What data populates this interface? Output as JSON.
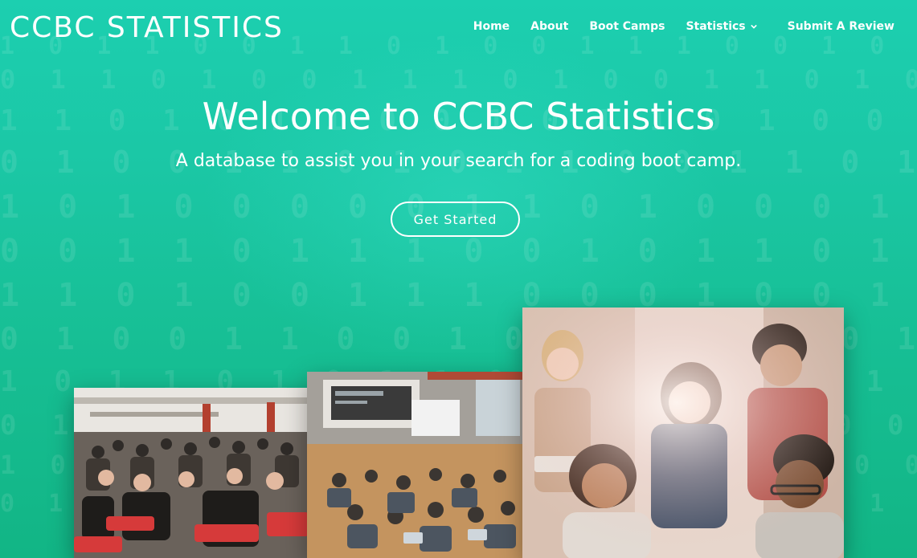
{
  "header": {
    "site_title": "CCBC STATISTICS"
  },
  "nav": {
    "items": [
      {
        "label": "Home"
      },
      {
        "label": "About"
      },
      {
        "label": "Boot Camps"
      },
      {
        "label": "Statistics"
      },
      {
        "label": "Submit A Review"
      }
    ]
  },
  "hero": {
    "title": "Welcome to CCBC Statistics",
    "subtitle": "A database to assist you in your search for a coding boot camp.",
    "cta_label": "Get Started"
  },
  "colors": {
    "background": "#1bc7a5",
    "text": "#ffffff"
  },
  "images": [
    {
      "description_icon": "lecture-hall-photo"
    },
    {
      "description_icon": "classroom-photo"
    },
    {
      "description_icon": "students-laptop-photo"
    }
  ]
}
